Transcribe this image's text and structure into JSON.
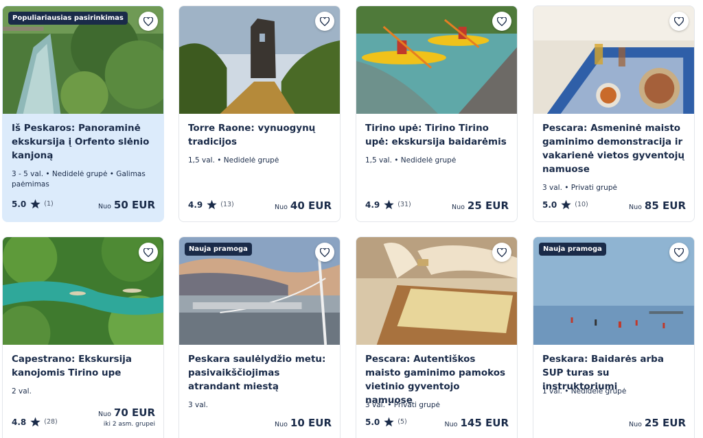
{
  "cards": [
    {
      "badge": "Populiariausias pasirinkimas",
      "title": "Iš Peskaros: Panoraminė ekskursija į Orfento slėnio kanjoną",
      "meta": "3 - 5 val. • Nedidelė grupė • Galimas paėmimas",
      "rating": "5.0",
      "reviews": "(1)",
      "price_prefix": "Nuo",
      "price": "50 EUR",
      "highlighted": true
    },
    {
      "title": "Torre Raone: vynuogynų tradicijos",
      "meta": "1,5 val. • Nedidelė grupė",
      "rating": "4.9",
      "reviews": "(13)",
      "price_prefix": "Nuo",
      "price": "40 EUR"
    },
    {
      "title": "Tirino upė: Tirino Tirino upė: ekskursija baidarėmis",
      "meta": "1,5 val. • Nedidelė grupė",
      "rating": "4.9",
      "reviews": "(31)",
      "price_prefix": "Nuo",
      "price": "25 EUR"
    },
    {
      "title": "Pescara: Asmeninė maisto gaminimo demonstracija ir vakarienė vietos gyventojų namuose",
      "meta": "3 val. • Privati grupė",
      "rating": "5.0",
      "reviews": "(10)",
      "price_prefix": "Nuo",
      "price": "85 EUR"
    },
    {
      "title": "Capestrano: Ekskursija kanojomis Tirino upe",
      "meta": "2 val.",
      "rating": "4.8",
      "reviews": "(28)",
      "price_prefix": "Nuo",
      "price": "70 EUR",
      "price_note": "iki 2 asm. grupei"
    },
    {
      "badge": "Nauja pramoga",
      "title": "Peskara saulėlydžio metu: pasivaikščiojimas atrandant miestą",
      "meta": "3 val.",
      "price_prefix": "Nuo",
      "price": "10 EUR"
    },
    {
      "title": "Pescara: Autentiškos maisto gaminimo pamokos vietinio gyventojo namuose",
      "meta": "3 val. • Privati grupė",
      "rating": "5.0",
      "reviews": "(5)",
      "price_prefix": "Nuo",
      "price": "145 EUR"
    },
    {
      "badge": "Nauja pramoga",
      "title": "Peskara: Baidarės arba SUP turas su instruktoriumi",
      "meta": "1 val. • Nedidelė grupė",
      "price_prefix": "Nuo",
      "price": "25 EUR"
    }
  ],
  "icons": {
    "wishlist": "heart-icon",
    "rating": "star-icon"
  },
  "colors": {
    "text": "#1a2b49",
    "highlight_bg": "#dcebfb",
    "badge_bg": "#1a2b49"
  }
}
